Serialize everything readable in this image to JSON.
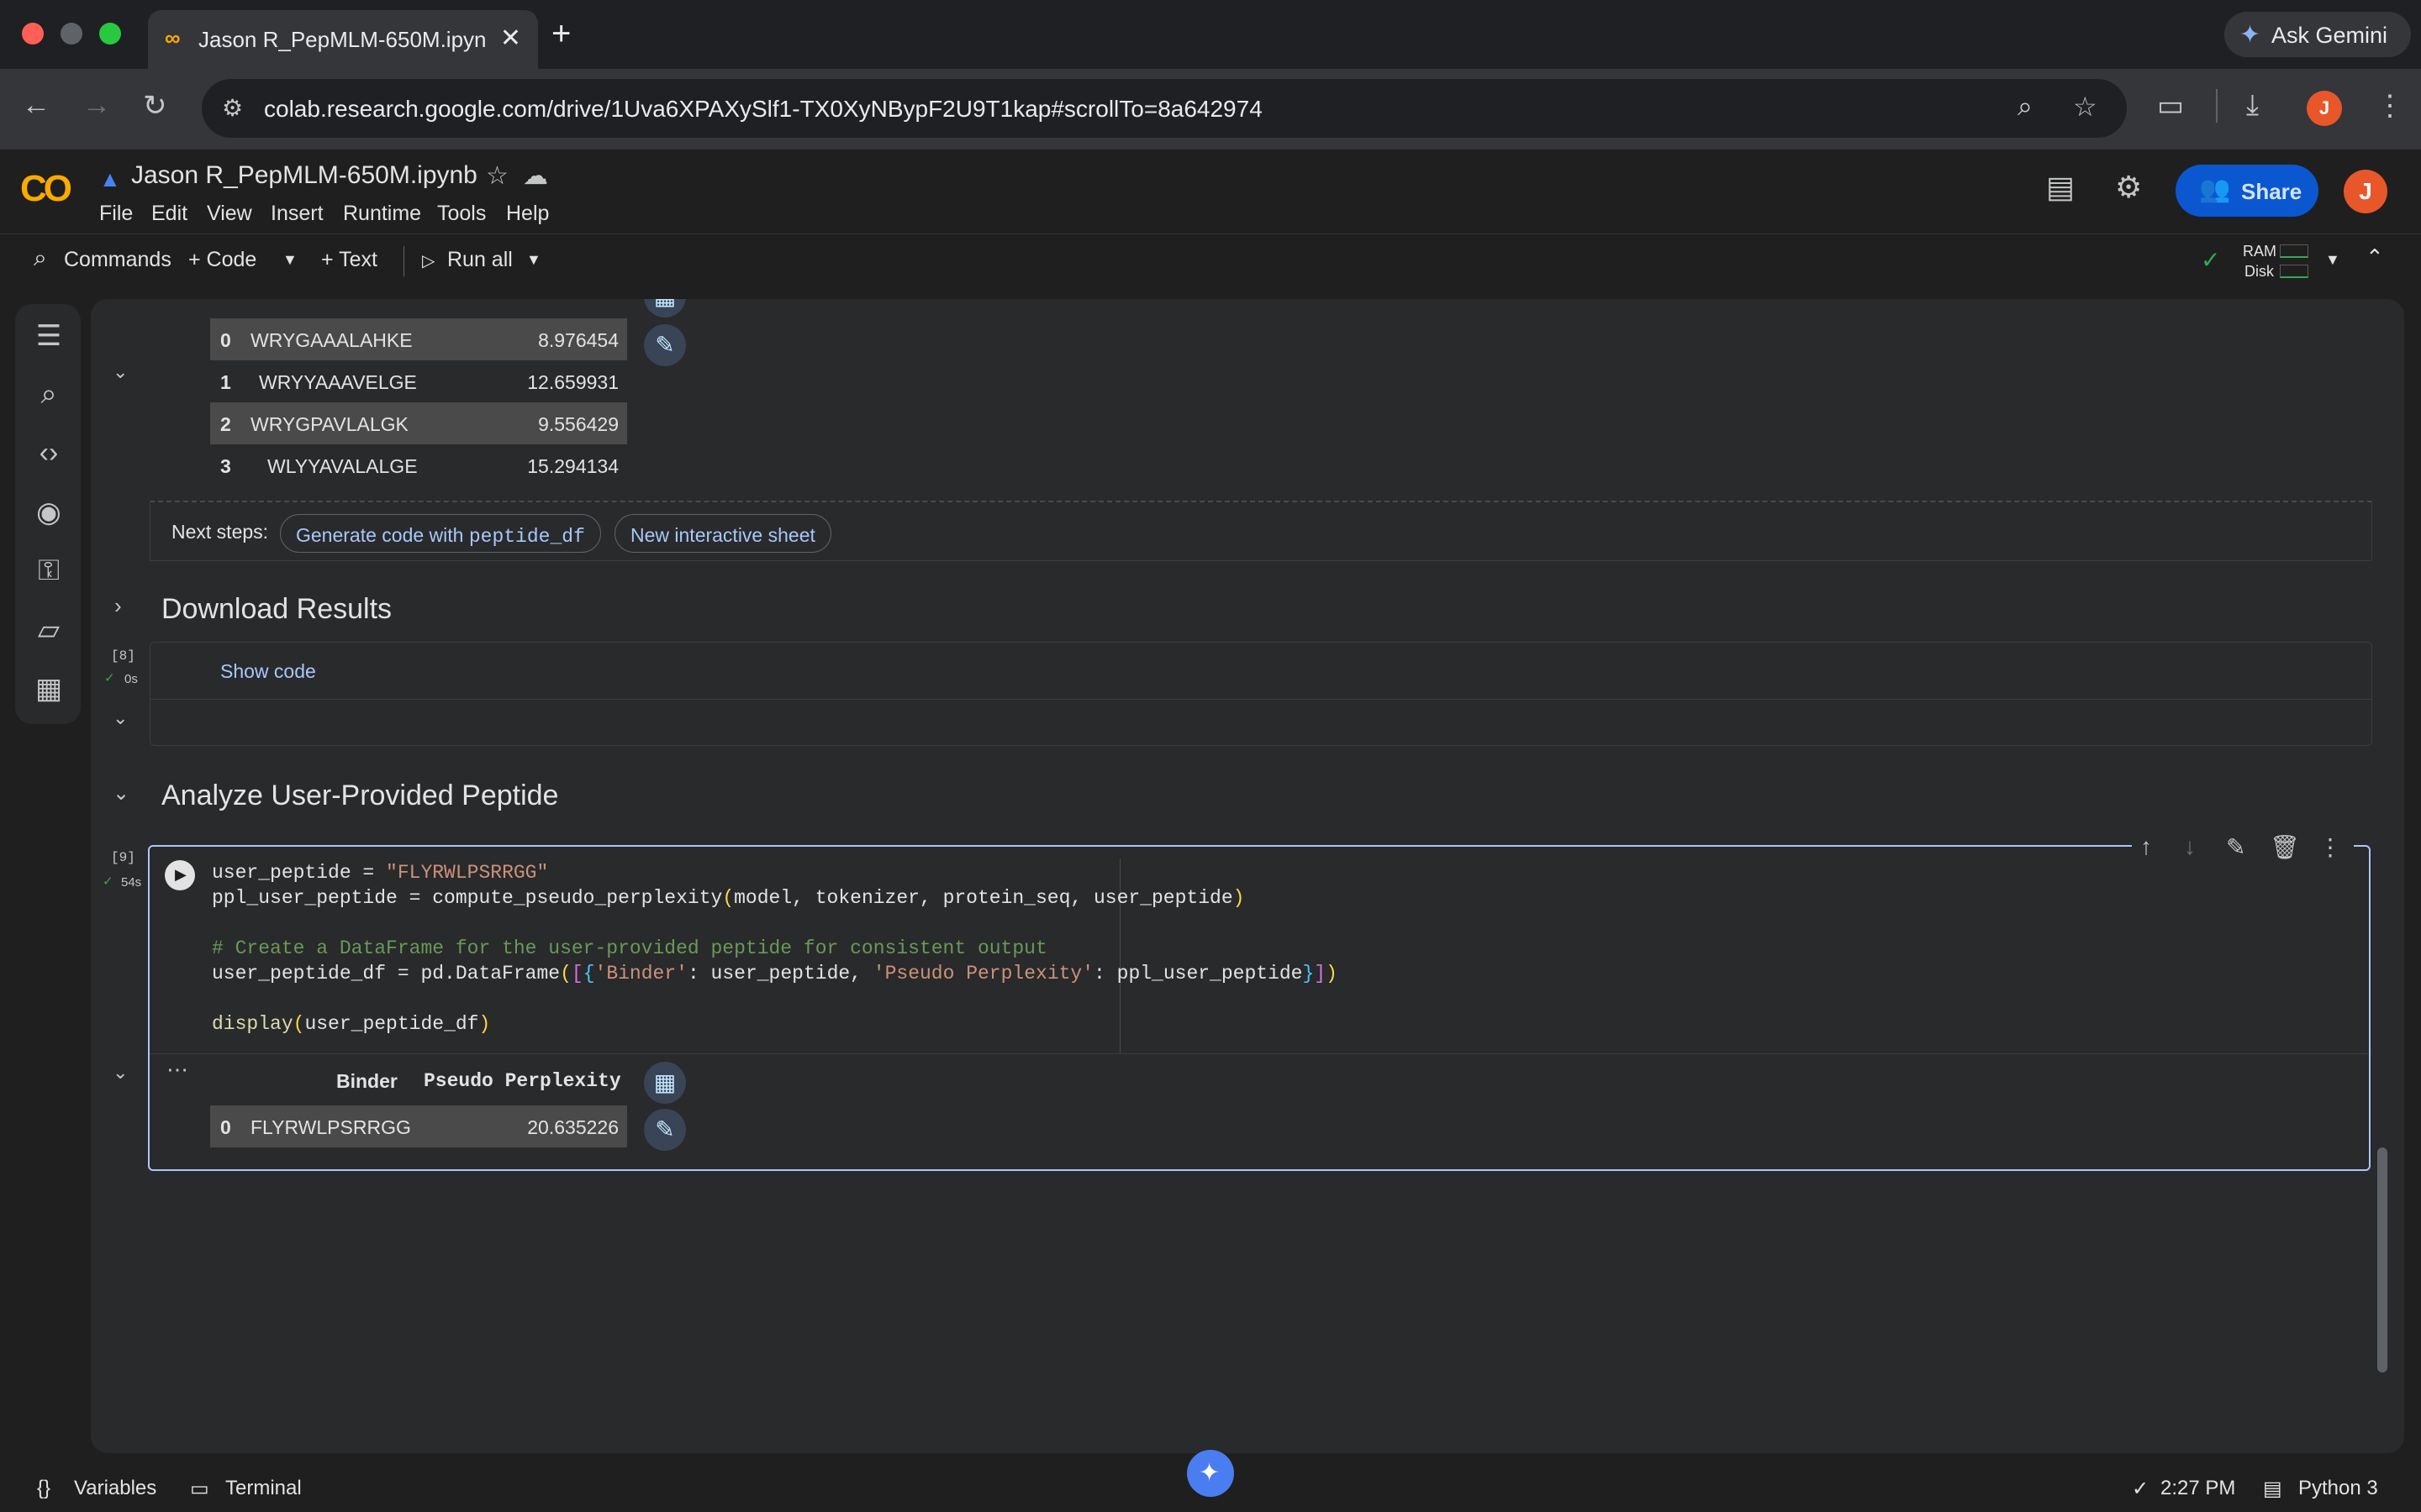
{
  "browser": {
    "tab_title": "Jason R_PepMLM-650M.ipyn",
    "new_tab_icon": "plus-icon",
    "url": "colab.research.google.com/drive/1Uva6XPAXySlf1-TX0XyNBypF2U9T1kap#scrollTo=8a642974",
    "ask_gemini": "Ask Gemini",
    "profile_initial": "J"
  },
  "colab": {
    "logo": "CO",
    "doc_name": "Jason R_PepMLM-650M.ipynb",
    "menu": [
      "File",
      "Edit",
      "View",
      "Insert",
      "Runtime",
      "Tools",
      "Help"
    ],
    "share_label": "Share",
    "user_initial": "J"
  },
  "toolbar": {
    "commands": "Commands",
    "code": "+ Code",
    "text": "+ Text",
    "run_all": "Run all",
    "ram": "RAM",
    "disk": "Disk"
  },
  "top_table": {
    "rows": [
      {
        "idx": "0",
        "binder": "WRYGAAALAHKE",
        "value": "8.976454"
      },
      {
        "idx": "1",
        "binder": "WRYYAAAVELGE",
        "value": "12.659931"
      },
      {
        "idx": "2",
        "binder": "WRYGPAVLALGK",
        "value": "9.556429"
      },
      {
        "idx": "3",
        "binder": "WLYYAVALALGE",
        "value": "15.294134"
      }
    ]
  },
  "next_steps": {
    "label": "Next steps:",
    "chip1_prefix": "Generate code with ",
    "chip1_code": "peptide_df",
    "chip2": "New interactive sheet"
  },
  "section_download": {
    "heading": "Download Results",
    "exec_num": "[8]",
    "exec_time": "0s",
    "show_code": "Show code"
  },
  "section_analyze": {
    "heading": "Analyze User-Provided Peptide",
    "exec_num": "[9]",
    "exec_time": "54s"
  },
  "code": {
    "l1a": "user_peptide = ",
    "l1b": "\"FLYRWLPSRRGG\"",
    "l2a": "ppl_user_peptide = compute_pseudo_perplexity",
    "l2b": "(",
    "l2c": "model, tokenizer, protein_seq, user_peptide",
    "l2d": ")",
    "l3": "# Create a DataFrame for the user-provided peptide for consistent output",
    "l4a": "user_peptide_df = pd.DataFrame",
    "l4b": "(",
    "l4c": "[",
    "l4d": "{",
    "l4e": "'Binder'",
    "l4f": ": user_peptide, ",
    "l4g": "'Pseudo Perplexity'",
    "l4h": ": ppl_user_peptide",
    "l4i": "}",
    "l4j": "]",
    "l4k": ")",
    "l5a": "display",
    "l5b": "(",
    "l5c": "user_peptide_df",
    "l5d": ")"
  },
  "output_table": {
    "col_binder": "Binder",
    "col_ppl": "Pseudo Perplexity",
    "rows": [
      {
        "idx": "0",
        "binder": "FLYRWLPSRRGG",
        "value": "20.635226"
      }
    ]
  },
  "statusbar": {
    "variables": "Variables",
    "terminal": "Terminal",
    "time": "2:27 PM",
    "runtime": "Python 3"
  }
}
